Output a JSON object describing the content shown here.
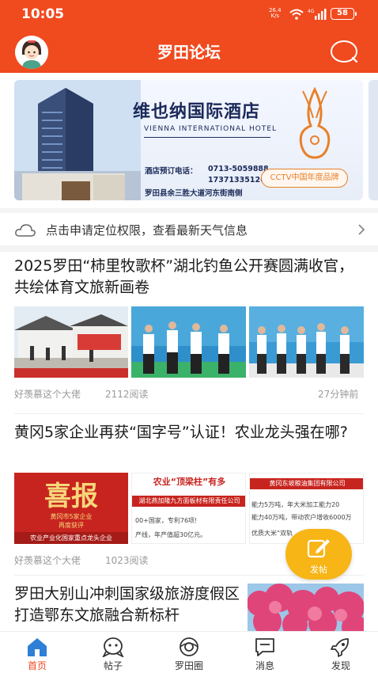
{
  "status_bar": {
    "time": "10:05",
    "net_speed": "26.4",
    "net_unit": "K/s",
    "battery": "58"
  },
  "header": {
    "title": "罗田论坛"
  },
  "banner": {
    "hotel_name": "维也纳国际酒店",
    "hotel_name_en": "VIENNA INTERNATIONAL HOTEL",
    "phone_label": "酒店预订电话：",
    "phone1": "0713-5059888",
    "phone2": "17371335126",
    "address": "罗田县余三胜大道河东街南侧",
    "badge": "CCTV中国年度品牌"
  },
  "weather": {
    "text": "点击申请定位权限，查看最新天气信息"
  },
  "articles": [
    {
      "title": "2025罗田“柿里牧歌杯”湖北钓鱼公开赛圆满收官，共绘体育文旅新画卷",
      "author": "好羡慕这个大佬",
      "reads": "2112阅读",
      "time": "27分钟前"
    },
    {
      "title": "黄冈5家企业再获“国字号”认证！农业龙头强在哪?",
      "author": "好羡慕这个大佬",
      "reads": "1023阅读",
      "thumb1_big": "喜报",
      "thumb1_line1": "黄冈市5家企业",
      "thumb1_line2": "再度获评",
      "thumb1_line3": "农业产业化国家重点龙头企业",
      "thumb2_head": "农业“顶梁柱”有多",
      "thumb2_sub": "湖北燕加隆九方面板材有限责任公司",
      "thumb2_l1": "00+国家，专利76项!",
      "thumb2_l2": "产线，年产值超30亿元。",
      "thumb3_head": "黄冈东坡粮油集团有限公司",
      "thumb3_l1": "能力5万吨，年大米加工能力20",
      "thumb3_l2": "能力40万吨，带动农户增收6000万",
      "thumb3_l3": "优质大米“双轨"
    },
    {
      "title": "罗田大别山冲刺国家级旅游度假区 打造鄂东文旅融合新标杆"
    }
  ],
  "fab": {
    "label": "发帖"
  },
  "nav": {
    "items": [
      {
        "label": "首页"
      },
      {
        "label": "帖子"
      },
      {
        "label": "罗田圈"
      },
      {
        "label": "消息"
      },
      {
        "label": "发现"
      }
    ]
  },
  "colors": {
    "brand": "#f04a1f",
    "fab": "#f7b516",
    "meta": "#9a9a9a"
  }
}
